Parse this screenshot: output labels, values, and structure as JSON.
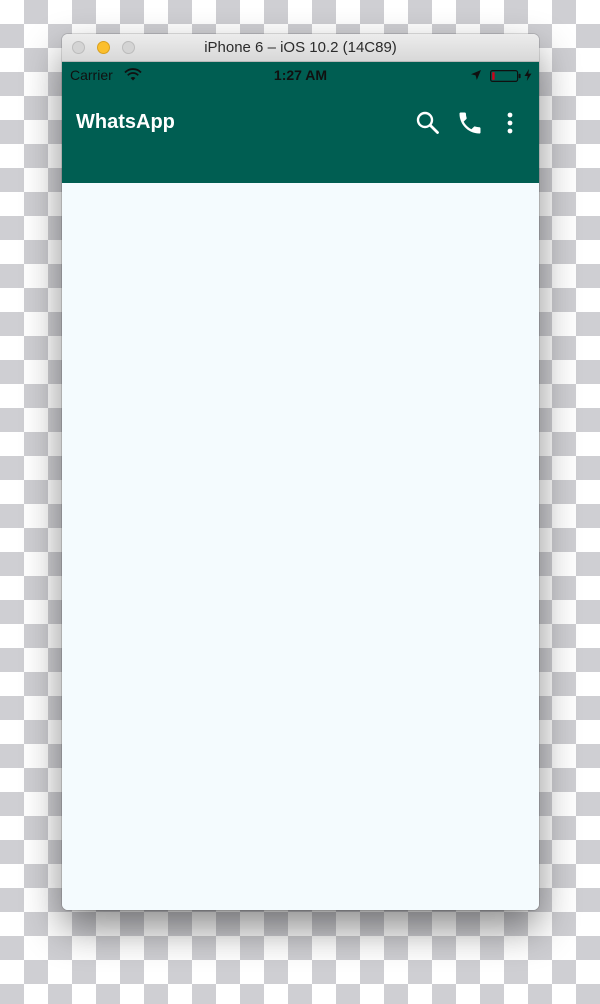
{
  "window": {
    "title": "iPhone 6 – iOS 10.2 (14C89)"
  },
  "status_bar": {
    "carrier": "Carrier",
    "time": "1:27 AM",
    "icons": [
      "wifi-icon",
      "location-icon",
      "battery-icon",
      "charging-icon"
    ]
  },
  "app_bar": {
    "title": "WhatsApp",
    "actions": [
      "search-icon",
      "phone-icon",
      "more-vert-icon"
    ]
  },
  "colors": {
    "app_bar": "#005e52",
    "content_background": "#f4fbfe",
    "battery_low": "#d0021b"
  }
}
